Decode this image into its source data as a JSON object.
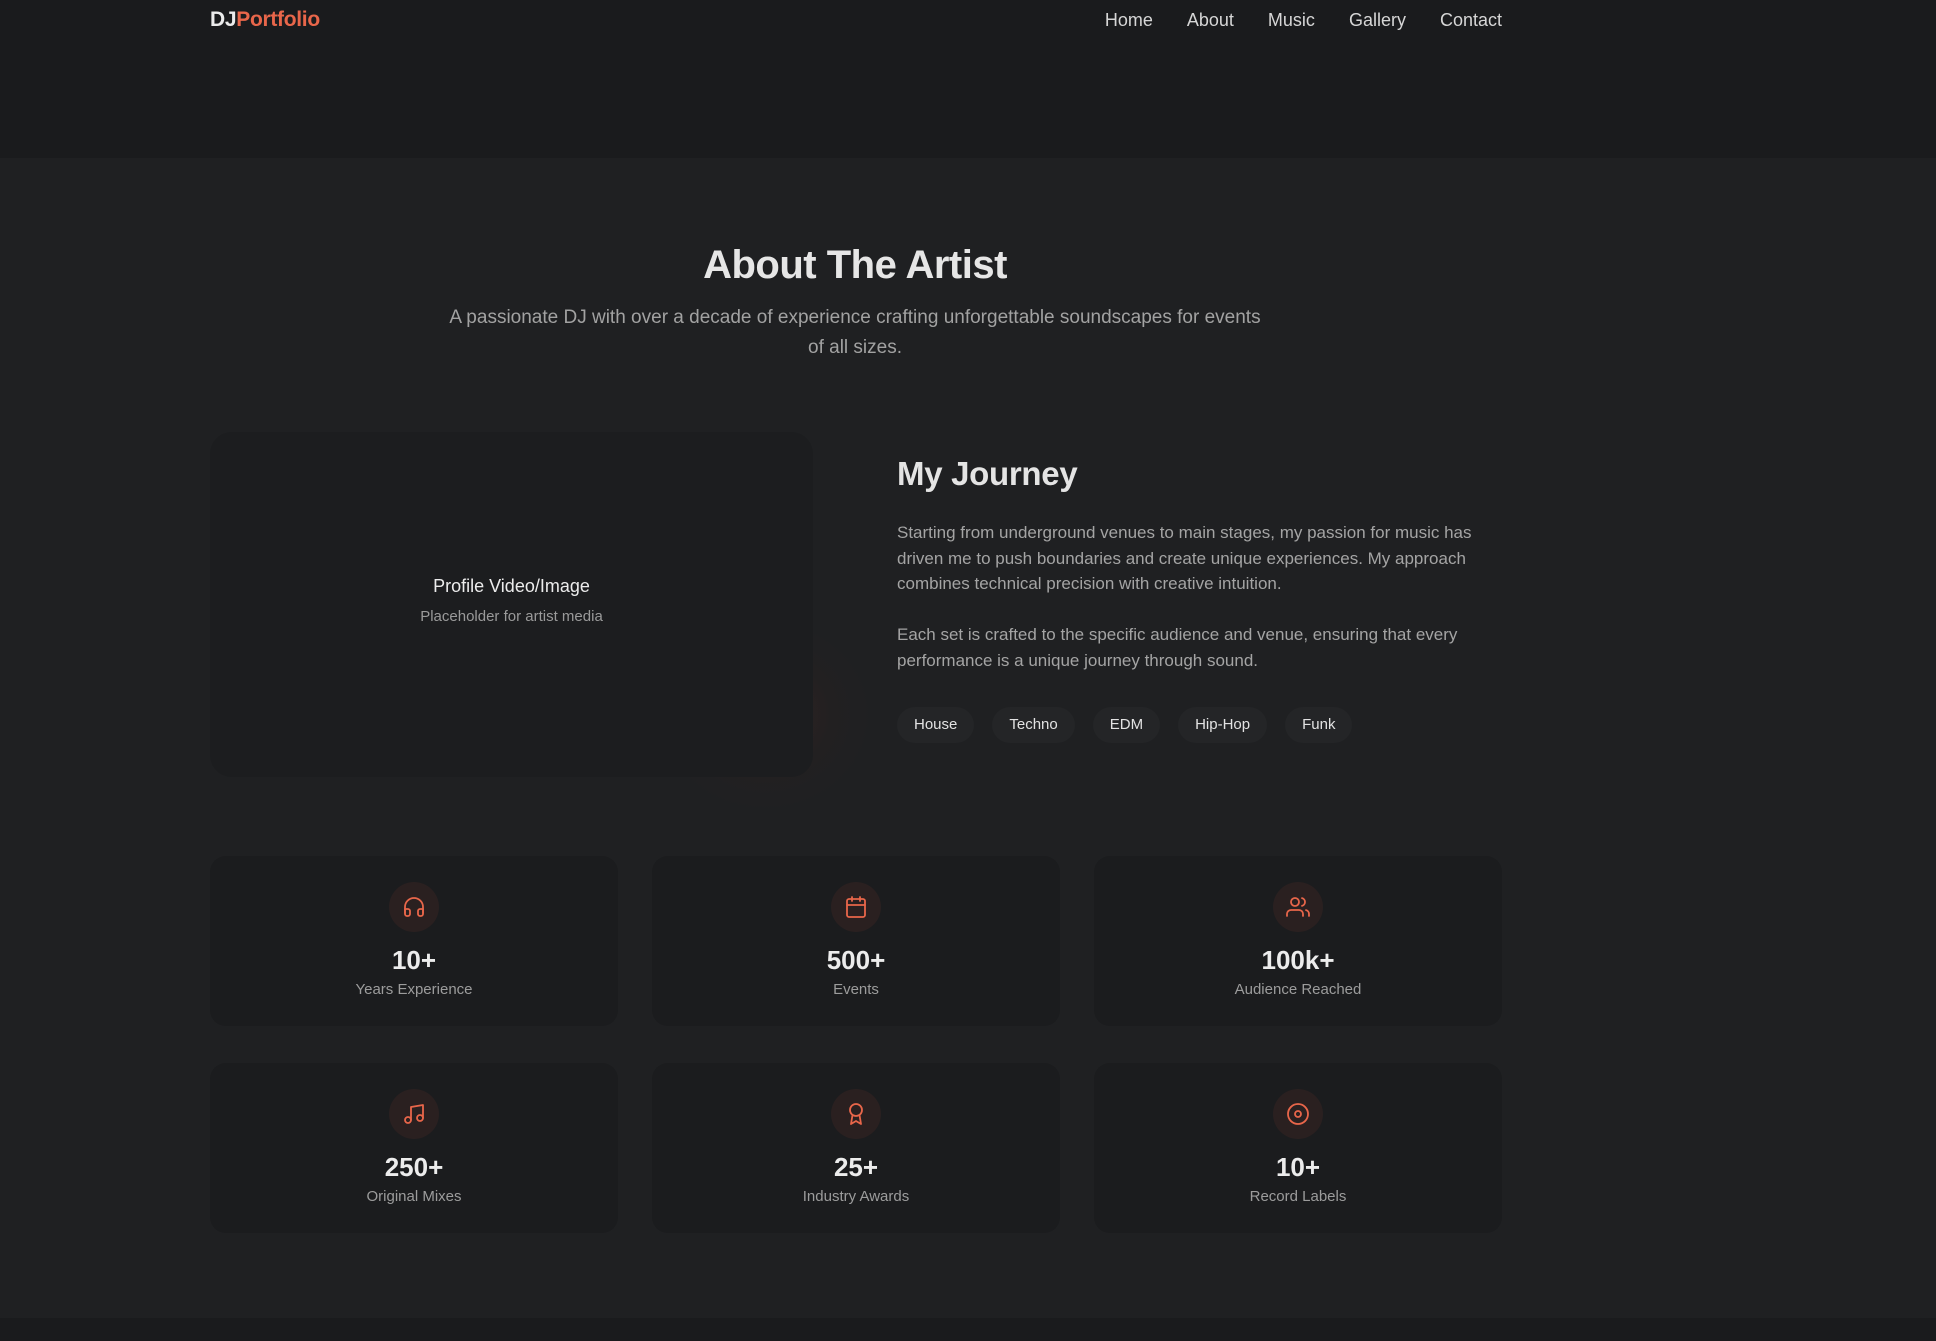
{
  "header": {
    "logo_part1": "DJ",
    "logo_part2": "Portfolio",
    "nav": [
      "Home",
      "About",
      "Music",
      "Gallery",
      "Contact"
    ]
  },
  "about": {
    "title": "About The Artist",
    "subtitle": "A passionate DJ with over a decade of experience crafting unforgettable soundscapes for events of all sizes.",
    "media": {
      "title": "Profile Video/Image",
      "subtitle": "Placeholder for artist media"
    },
    "journey": {
      "title": "My Journey",
      "paragraph1": "Starting from underground venues to main stages, my passion for music has driven me to push boundaries and create unique experiences. My approach combines technical precision with creative intuition.",
      "paragraph2": "Each set is crafted to the specific audience and venue, ensuring that every performance is a unique journey through sound.",
      "tags": [
        "House",
        "Techno",
        "EDM",
        "Hip-Hop",
        "Funk"
      ]
    },
    "stats": [
      {
        "icon": "headphones-icon",
        "value": "10+",
        "label": "Years Experience"
      },
      {
        "icon": "calendar-icon",
        "value": "500+",
        "label": "Events"
      },
      {
        "icon": "users-icon",
        "value": "100k+",
        "label": "Audience Reached"
      },
      {
        "icon": "music-note-icon",
        "value": "250+",
        "label": "Original Mixes"
      },
      {
        "icon": "award-icon",
        "value": "25+",
        "label": "Industry Awards"
      },
      {
        "icon": "disc-icon",
        "value": "10+",
        "label": "Record Labels"
      }
    ]
  },
  "colors": {
    "accent": "#e8664a",
    "background": "#1f2022",
    "header_background": "#1a1b1d",
    "card_background": "#1b1c1e"
  }
}
